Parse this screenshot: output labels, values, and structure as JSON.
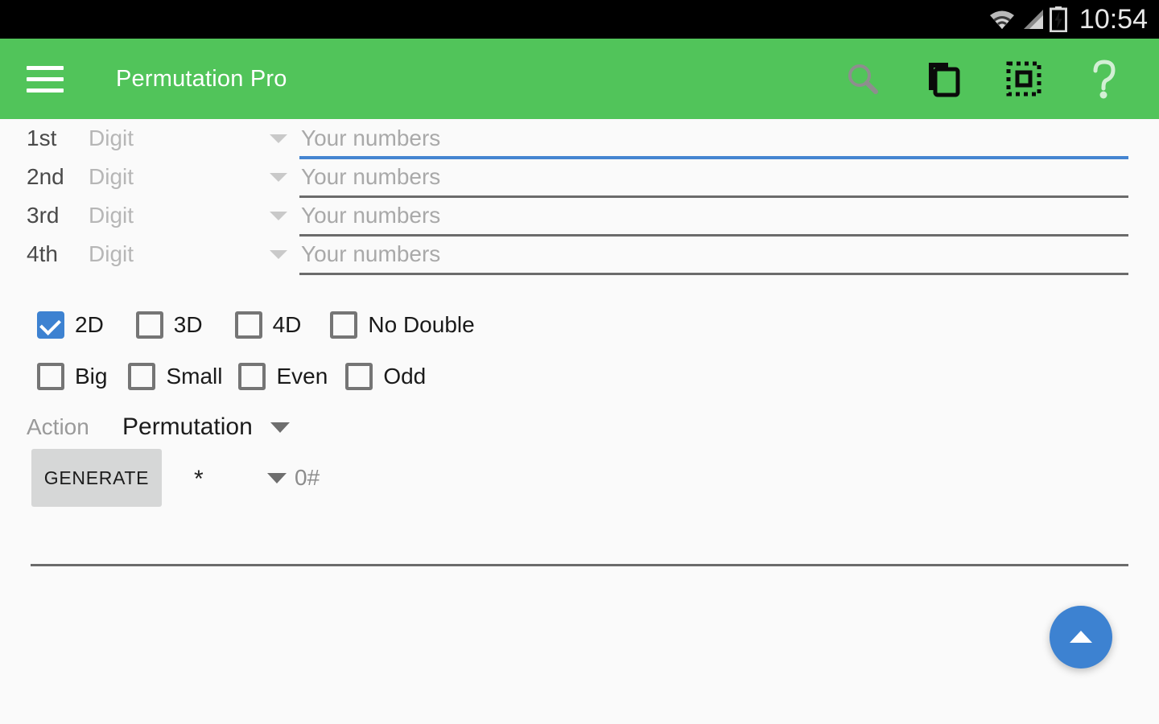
{
  "statusbar": {
    "clock": "10:54",
    "icons": [
      "wifi-icon",
      "cellular-signal-icon",
      "battery-charging-icon"
    ]
  },
  "toolbar": {
    "title": "Permutation Pro",
    "menu_icon": "hamburger-menu-icon",
    "actions": [
      {
        "name": "search-icon",
        "label": "Search"
      },
      {
        "name": "copy-icon",
        "label": "Copy"
      },
      {
        "name": "select-all-icon",
        "label": "Select All"
      },
      {
        "name": "help-icon",
        "label": "Help"
      }
    ],
    "background_color": "#51C45A"
  },
  "form": {
    "rows": [
      {
        "ordinal": "1st",
        "digit_placeholder": "Digit",
        "numbers_placeholder": "Your numbers",
        "value": "",
        "focused": true
      },
      {
        "ordinal": "2nd",
        "digit_placeholder": "Digit",
        "numbers_placeholder": "Your numbers",
        "value": "",
        "focused": false
      },
      {
        "ordinal": "3rd",
        "digit_placeholder": "Digit",
        "numbers_placeholder": "Your numbers",
        "value": "",
        "focused": false
      },
      {
        "ordinal": "4th",
        "digit_placeholder": "Digit",
        "numbers_placeholder": "Your numbers",
        "value": "",
        "focused": false
      }
    ],
    "checkbox_rows": [
      [
        {
          "label": "2D",
          "checked": true
        },
        {
          "label": "3D",
          "checked": false
        },
        {
          "label": "4D",
          "checked": false
        },
        {
          "label": "No Double",
          "checked": false
        }
      ],
      [
        {
          "label": "Big",
          "checked": false
        },
        {
          "label": "Small",
          "checked": false
        },
        {
          "label": "Even",
          "checked": false
        },
        {
          "label": "Odd",
          "checked": false
        }
      ]
    ],
    "action": {
      "label": "Action",
      "value": "Permutation"
    },
    "generate": {
      "button_label": "GENERATE",
      "star": "*",
      "count": "0#"
    }
  },
  "fab": {
    "name": "scroll-up-fab",
    "icon": "chevron-up-icon",
    "color": "#3D82D1"
  },
  "colors": {
    "accent_green": "#51C45A",
    "accent_blue": "#3D82D1",
    "focus_underline": "#4585D1",
    "page_background": "#FAFAFA",
    "button_gray": "#D6D7D7"
  }
}
